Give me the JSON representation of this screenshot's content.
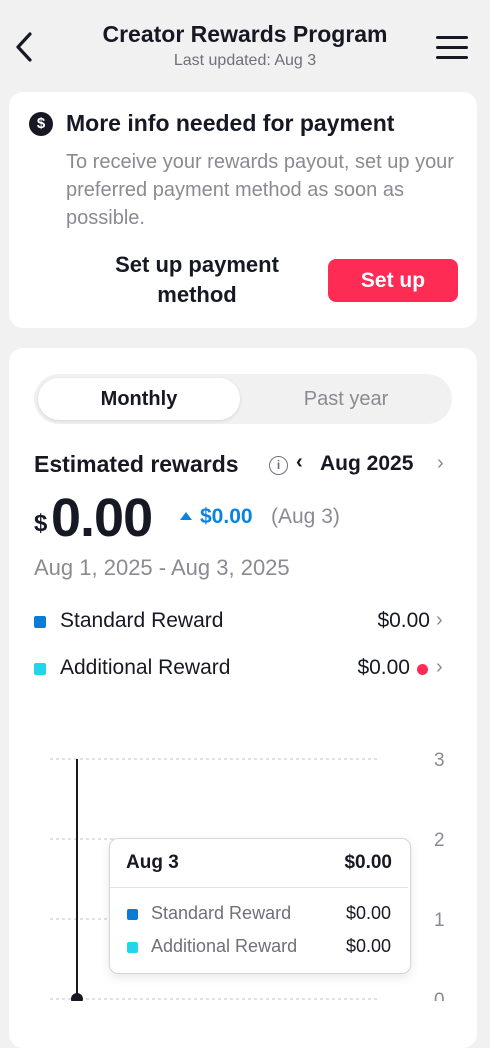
{
  "header": {
    "title": "Creator Rewards Program",
    "subtitle": "Last updated: Aug 3"
  },
  "payment_card": {
    "icon": "dollar-icon",
    "title": "More info needed for payment",
    "description": "To receive your rewards payout, set up your preferred payment method as soon as possible.",
    "action_text": "Set up payment method",
    "button_label": "Set up",
    "button_color": "#fe2c55"
  },
  "tabs": {
    "active": "Monthly",
    "inactive": "Past year"
  },
  "rewards": {
    "label": "Estimated rewards",
    "month": "Aug 2025",
    "currency_symbol": "$",
    "amount": "0.00",
    "change_amount": "$0.00",
    "change_date": "(Aug 3)",
    "date_range": "Aug 1, 2025 - Aug 3, 2025"
  },
  "breakdown": [
    {
      "label": "Standard Reward",
      "value": "$0.00",
      "color": "#0b7bd8",
      "alert": false
    },
    {
      "label": "Additional Reward",
      "value": "$0.00",
      "color": "#20d5ec",
      "alert": true
    }
  ],
  "chart_data": {
    "type": "bar",
    "title": "",
    "categories": [
      "Aug 3"
    ],
    "series": [
      {
        "name": "Standard Reward",
        "values": [
          0
        ]
      },
      {
        "name": "Additional Reward",
        "values": [
          0
        ]
      }
    ],
    "yticks": [
      "3",
      "2",
      "1",
      "0"
    ],
    "ylim": [
      0,
      3
    ],
    "grid": true
  },
  "tooltip": {
    "date": "Aug 3",
    "total": "$0.00",
    "rows": [
      {
        "label": "Standard Reward",
        "value": "$0.00",
        "color": "#0b7bd8"
      },
      {
        "label": "Additional Reward",
        "value": "$0.00",
        "color": "#20d5ec"
      }
    ]
  }
}
